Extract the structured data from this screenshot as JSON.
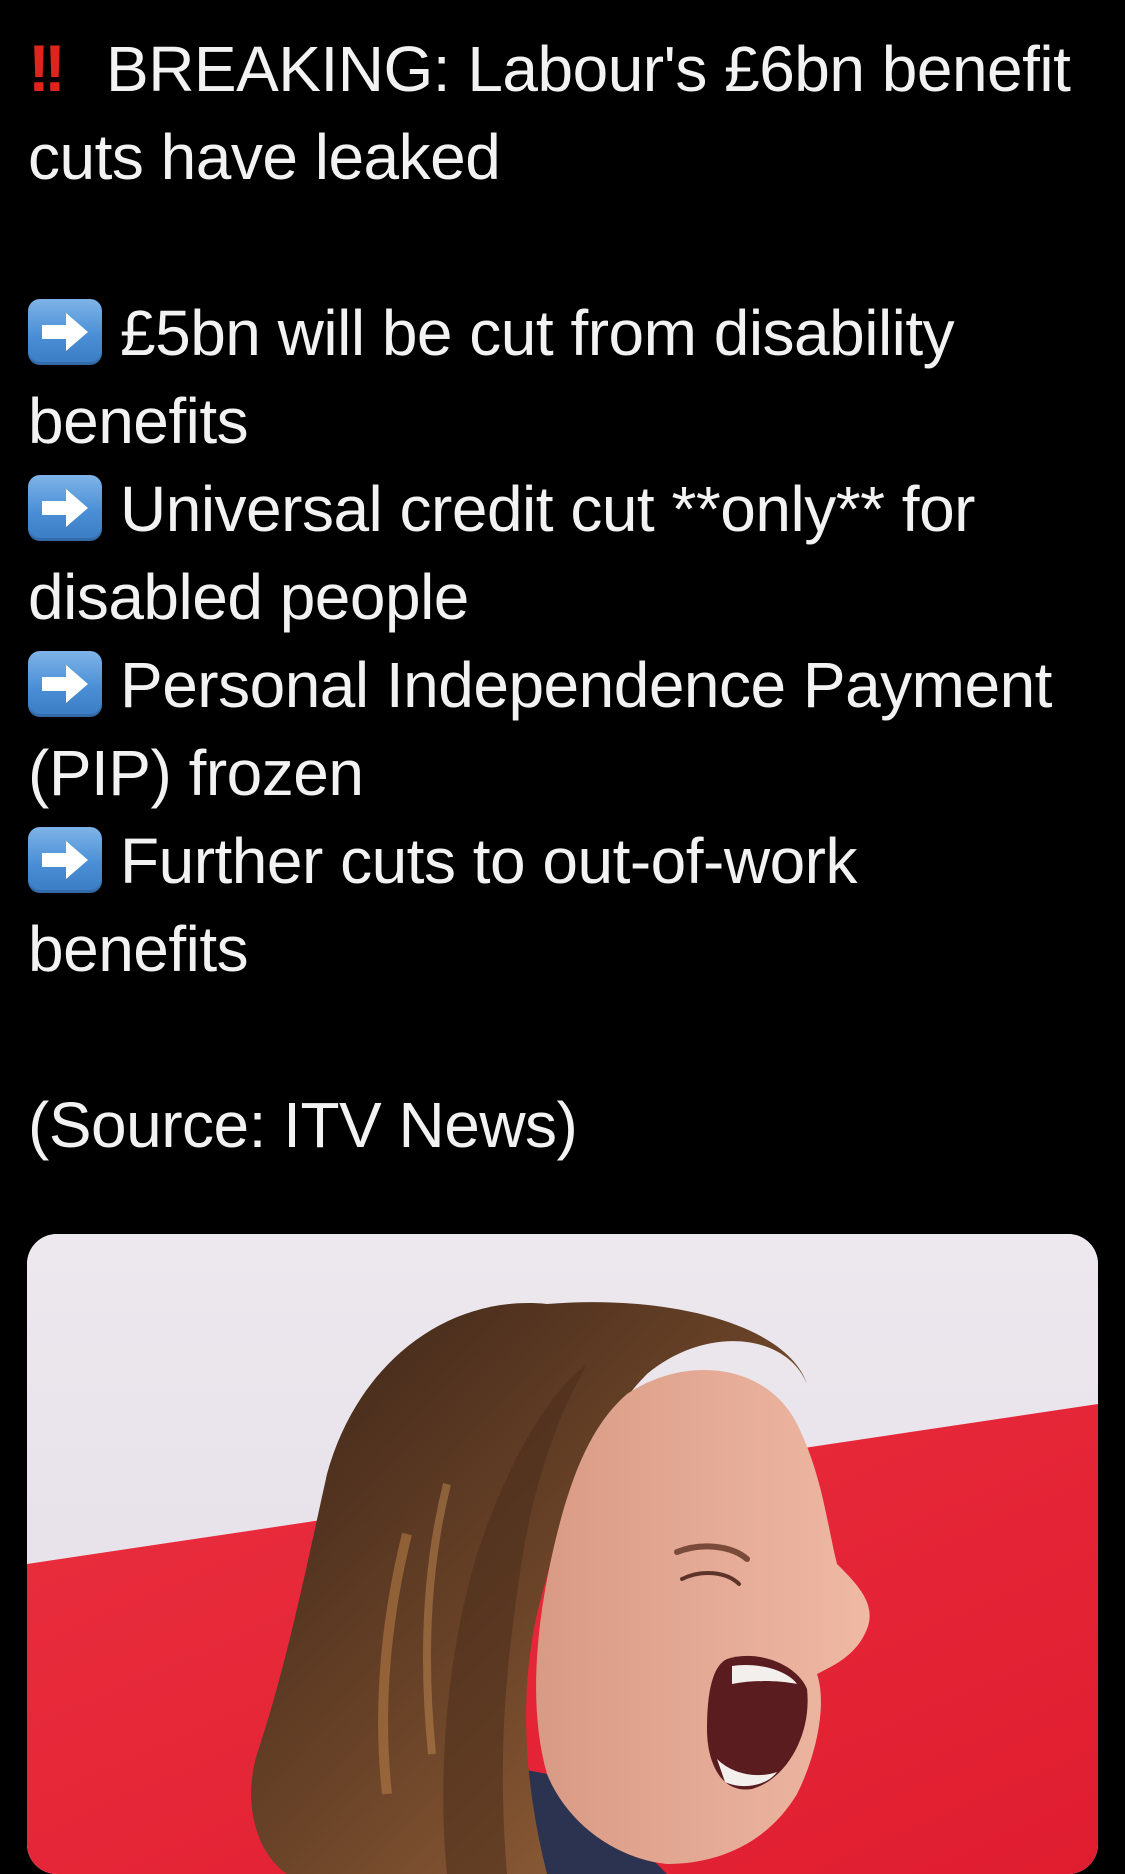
{
  "tweet": {
    "headline_icon": "double-exclamation-icon",
    "headline_line1": "BREAKING: Labour's £6bn benefit",
    "headline_line2": "cuts have leaked",
    "bullet_icon": "right-arrow-icon",
    "bullets": [
      {
        "line1": "£5bn will be cut from disability",
        "line2": "benefits"
      },
      {
        "line1": "Universal credit cut **only** for",
        "line2": "disabled people"
      },
      {
        "line1": "Personal Independence Payment",
        "line2": "(PIP) frozen"
      },
      {
        "line1": "Further cuts to out-of-work",
        "line2": "benefits"
      }
    ],
    "source": "(Source: ITV News)"
  },
  "colors": {
    "background": "#000000",
    "text": "#f2f2f2",
    "alert_red": "#e0241b",
    "arrow_blue": "#4a8fd6",
    "photo_red": "#e8283a"
  }
}
